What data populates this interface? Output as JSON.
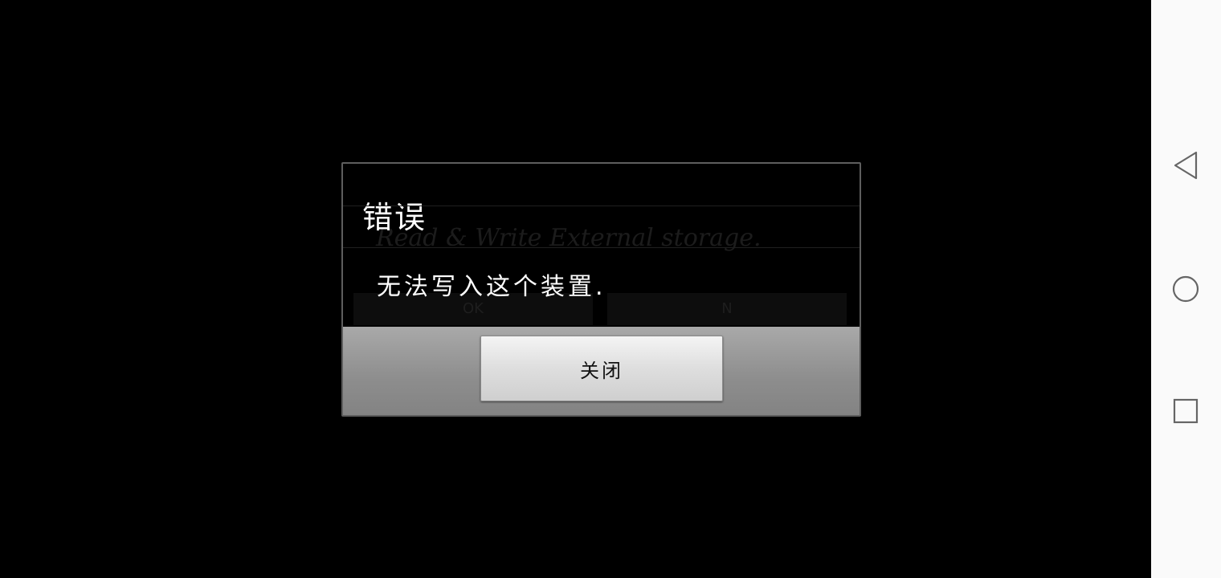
{
  "background_dialog": {
    "message": "Read & Write External storage.",
    "ok_label": "OK",
    "no_label": "N"
  },
  "error_dialog": {
    "title": "错误",
    "message": "无法写入这个装置.",
    "close_label": "关闭"
  },
  "navbar": {
    "items": [
      "back-icon",
      "home-icon",
      "recents-icon"
    ],
    "icon_color": "#666666"
  },
  "colors": {
    "background": "#000000",
    "navbar": "#fafafa",
    "dialog_border": "#5e5e5e",
    "button_bar": "#9a9a9a"
  }
}
